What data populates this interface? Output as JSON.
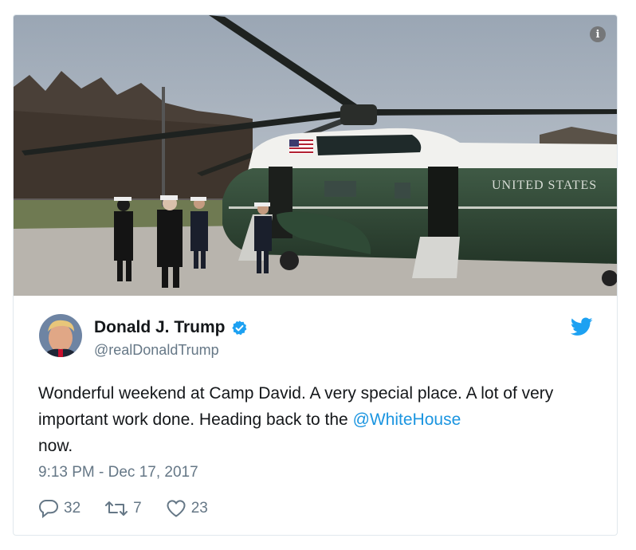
{
  "tweet": {
    "author_name": "Donald J. Trump",
    "handle": "@realDonaldTrump",
    "text_before": "Wonderful weekend at Camp David. A very special place. A lot of very important work done. Heading back to the ",
    "mention": "@WhiteHouse",
    "text_after": "now.",
    "timestamp": "9:13 PM - Dec 17, 2017",
    "reply_count": "32",
    "retweet_count": "7",
    "like_count": "23",
    "helicopter_text": "UNITED STATES"
  },
  "icons": {
    "info": "info-icon",
    "verified": "verified-badge-icon",
    "brand": "twitter-bird-icon",
    "reply": "reply-icon",
    "retweet": "retweet-icon",
    "like": "heart-icon"
  },
  "colors": {
    "link": "#1b95e0",
    "muted": "#657786",
    "verified": "#1da1f2"
  }
}
